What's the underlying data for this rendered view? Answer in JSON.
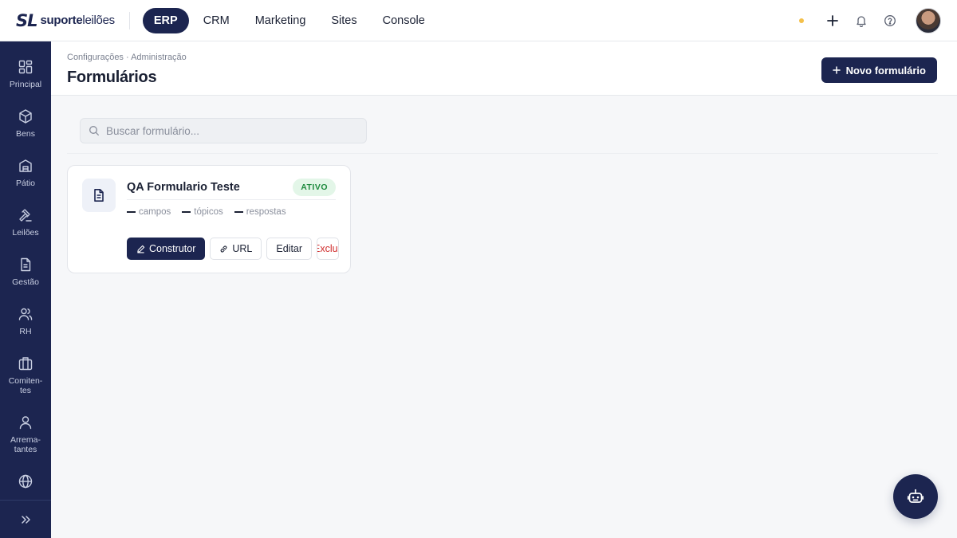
{
  "brand": {
    "mark": "SL",
    "name_bold": "suporte",
    "name_light": "leilões"
  },
  "topnav": {
    "items": [
      {
        "label": "ERP",
        "active": true
      },
      {
        "label": "CRM"
      },
      {
        "label": "Marketing"
      },
      {
        "label": "Sites"
      },
      {
        "label": "Console"
      }
    ]
  },
  "topbar_icons": [
    "status-dot",
    "plus-icon",
    "bell-icon",
    "help-icon",
    "user-avatar"
  ],
  "sidebar": {
    "items": [
      {
        "label": "Principal",
        "icon": "dashboard-icon"
      },
      {
        "label": "Bens",
        "icon": "box-icon"
      },
      {
        "label": "Pátio",
        "icon": "warehouse-icon"
      },
      {
        "label": "Leilões",
        "icon": "gavel-icon"
      },
      {
        "label": "Gestão",
        "icon": "document-icon"
      },
      {
        "label": "RH",
        "icon": "people-icon"
      },
      {
        "label": "Comiten-\ntes",
        "icon": "briefcase-icon"
      },
      {
        "label": "Arrema-\ntantes",
        "icon": "user-icon"
      },
      {
        "label": "",
        "icon": "globe-icon"
      }
    ],
    "footer_icon": "expand-icon"
  },
  "page": {
    "breadcrumb": "Configurações · Administração",
    "title": "Formulários",
    "new_button": "Novo formulário"
  },
  "search": {
    "placeholder": "Buscar formulário..."
  },
  "forms": [
    {
      "title": "QA Formulario Teste",
      "status": "ATIVO",
      "stats": [
        {
          "value": "—",
          "label": "campos"
        },
        {
          "value": "—",
          "label": "tópicos"
        },
        {
          "value": "—",
          "label": "respostas"
        }
      ],
      "actions": {
        "builder": "Construtor",
        "url": "URL",
        "edit": "Editar",
        "delete": "Excluir"
      }
    }
  ],
  "colors": {
    "primary": "#1c2550",
    "badge_bg": "#e3f6e8",
    "badge_text": "#1e8a3e",
    "danger": "#d02d2d",
    "status_dot": "#f4c04a"
  }
}
